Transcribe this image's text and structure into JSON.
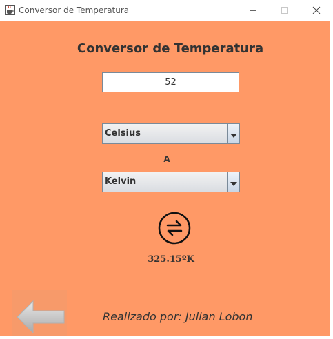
{
  "window": {
    "title": "Conversor de Temperatura",
    "icons": {
      "app": "java-cup-icon",
      "minimize": "minimize-icon",
      "maximize": "maximize-icon",
      "close": "close-icon"
    }
  },
  "main": {
    "heading": "Conversor de Temperatura",
    "input_value": "52",
    "from_unit": "Celsius",
    "connector": "A",
    "to_unit": "Kelvin",
    "swap_icon": "swap-arrows-icon",
    "result": "325.15ºK",
    "back_icon": "back-arrow-icon",
    "credit": "Realizado por: Julian Lobon"
  },
  "colors": {
    "background": "#ff9966",
    "text": "#333333"
  }
}
